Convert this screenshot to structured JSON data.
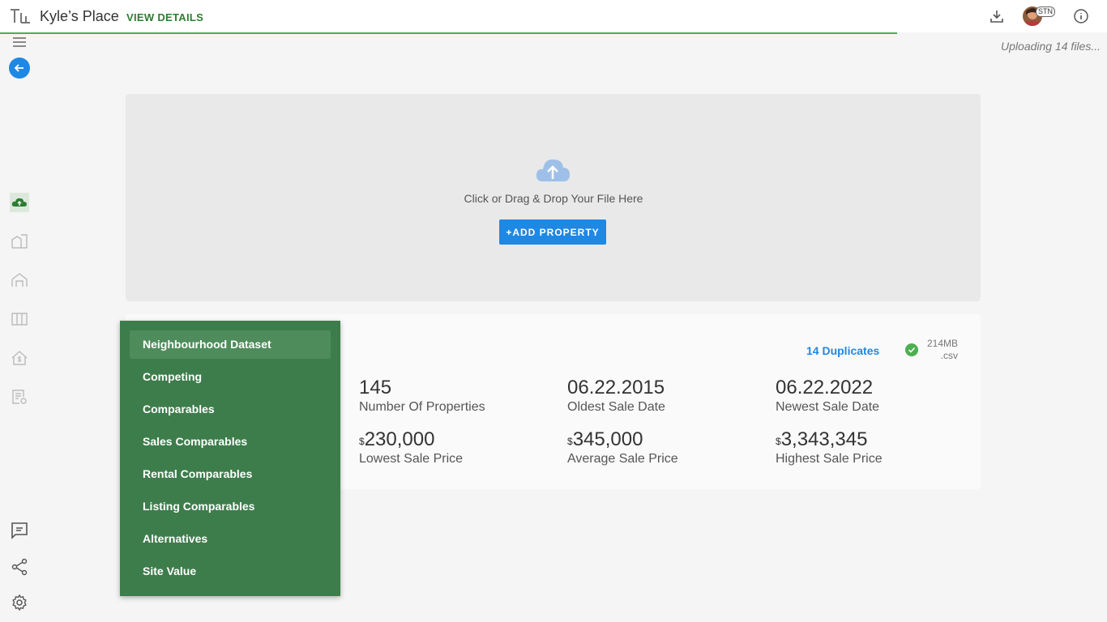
{
  "header": {
    "title": "Kyle’s Place",
    "view_details": "VIEW DETAILS",
    "avatar_badge": "STN",
    "upload_status": "Uploading 14 files..."
  },
  "dropzone": {
    "instruction": "Click or Drag & Drop Your File Here",
    "add_button": "+ADD PROPERTY"
  },
  "summary": {
    "duplicates": "14 Duplicates",
    "file_size": "214MB",
    "file_ext": ".csv",
    "stats": [
      {
        "value": "145",
        "label": "Number Of Properties"
      },
      {
        "value": "06.22.2015",
        "label": "Oldest Sale Date"
      },
      {
        "value": "06.22.2022",
        "label": "Newest Sale Date"
      },
      {
        "currency": "$",
        "value": "230,000",
        "label": "Lowest Sale Price"
      },
      {
        "currency": "$",
        "value": "345,000",
        "label": "Average Sale Price"
      },
      {
        "currency": "$",
        "value": "3,343,345",
        "label": "Highest Sale Price"
      }
    ]
  },
  "dataset_menu": {
    "items": [
      "Neighbourhood Dataset",
      "Competing",
      "Comparables",
      "Sales Comparables",
      "Rental Comparables",
      "Listing Comparables",
      "Alternatives",
      "Site Value"
    ],
    "active_index": 0
  },
  "colors": {
    "accent_blue": "#1e88e5",
    "menu_green": "#3d7d4b",
    "progress_green": "#4caf50"
  },
  "icons": {
    "top_right": [
      "download-icon",
      "info-icon"
    ],
    "sidebar": [
      "menu-icon",
      "back-arrow-icon",
      "cloud-upload-icon",
      "building-icon",
      "house-icon",
      "columns-icon",
      "home-dollar-icon",
      "document-settings-icon",
      "feedback-icon",
      "share-icon",
      "gear-icon"
    ]
  }
}
